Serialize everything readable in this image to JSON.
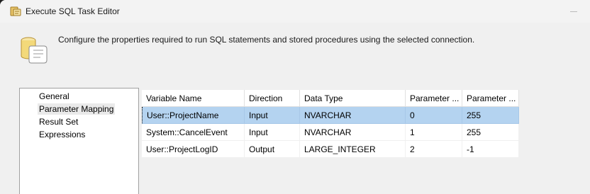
{
  "window": {
    "title": "Execute SQL Task Editor",
    "description": "Configure the properties required to run SQL statements and stored procedures using the selected connection."
  },
  "nav": {
    "items": [
      {
        "label": "General"
      },
      {
        "label": "Parameter Mapping",
        "selected": true
      },
      {
        "label": "Result Set"
      },
      {
        "label": "Expressions"
      }
    ]
  },
  "grid": {
    "columns": [
      "Variable Name",
      "Direction",
      "Data Type",
      "Parameter ...",
      "Parameter ..."
    ],
    "rows": [
      [
        "User::ProjectName",
        "Input",
        "NVARCHAR",
        "0",
        "255"
      ],
      [
        "System::CancelEvent",
        "Input",
        "NVARCHAR",
        "1",
        "255"
      ],
      [
        "User::ProjectLogID",
        "Output",
        "LARGE_INTEGER",
        "2",
        "-1"
      ]
    ],
    "selected_row": 0
  },
  "colors": {
    "selection": "#b4d3f0",
    "background": "#f0f0f0"
  }
}
